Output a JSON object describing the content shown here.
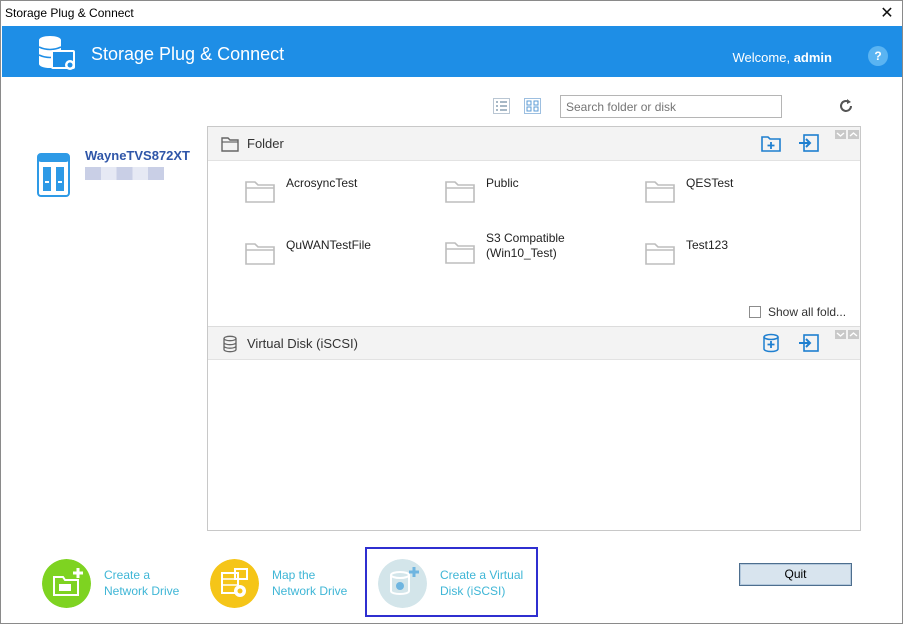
{
  "window": {
    "title": "Storage Plug & Connect",
    "close_glyph": "✕"
  },
  "header": {
    "app_title": "Storage Plug & Connect",
    "welcome_prefix": "Welcome,",
    "username": "admin",
    "help_glyph": "?",
    "logo_icon": "storage-database-icon"
  },
  "toolbar": {
    "search_placeholder": "Search folder or disk",
    "list_view_icon": "list-view-icon",
    "grid_view_icon": "grid-view-icon",
    "refresh_icon": "refresh-icon"
  },
  "device": {
    "name": "WayneTVS872XT",
    "icon": "nas-device-icon"
  },
  "folder_section": {
    "label": "Folder",
    "folders": [
      {
        "name": "AcrosyncTest"
      },
      {
        "name": "Public"
      },
      {
        "name": "QESTest"
      },
      {
        "name": "QuWANTestFile"
      },
      {
        "name": "S3 Compatible\n(Win10_Test)"
      },
      {
        "name": "Test123"
      }
    ],
    "show_all_label": "Show all fold..."
  },
  "disk_section": {
    "label": "Virtual Disk (iSCSI)"
  },
  "actions": [
    {
      "label": "Create a\nNetwork Drive",
      "icon": "create-network-drive-icon",
      "color": "#7ed321"
    },
    {
      "label": "Map the\nNetwork Drive",
      "icon": "map-network-drive-icon",
      "color": "#f5c518"
    },
    {
      "label": "Create a Virtual\nDisk (iSCSI)",
      "icon": "create-virtual-disk-icon",
      "color": "#d3e5ea"
    }
  ],
  "quit_label": "Quit",
  "colors": {
    "header_bg": "#1e8ee6",
    "action_text": "#3fb6d6",
    "highlight_border": "#2f2fd0"
  }
}
